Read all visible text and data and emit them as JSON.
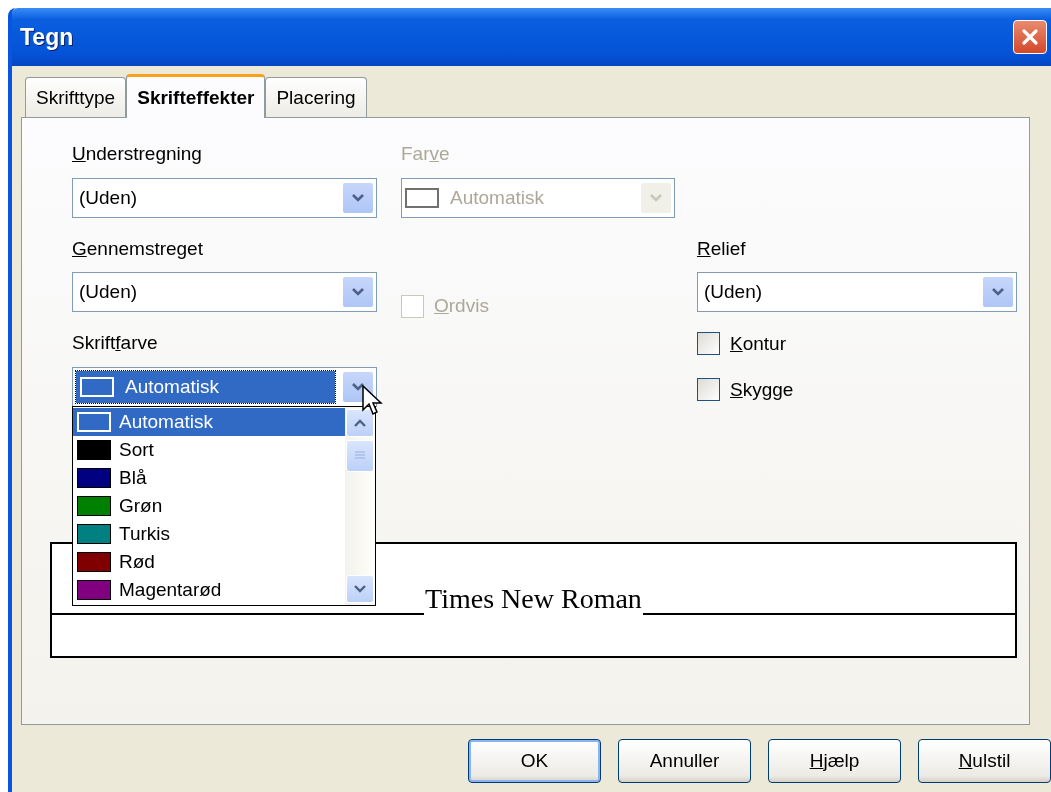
{
  "window": {
    "title": "Tegn"
  },
  "tabs": [
    {
      "label": "Skrifttype",
      "selected": false
    },
    {
      "label": "Skrifteffekter",
      "selected": true
    },
    {
      "label": "Placering",
      "selected": false
    }
  ],
  "understregning": {
    "label_parts": [
      {
        "text": "U",
        "underline": true
      },
      {
        "text": "nderstregning",
        "underline": false
      }
    ],
    "value": "(Uden)",
    "disabled": false
  },
  "farve": {
    "label_parts": [
      {
        "text": "Far",
        "underline": false
      },
      {
        "text": "v",
        "underline": true
      },
      {
        "text": "e",
        "underline": false
      }
    ],
    "value": "Automatisk",
    "disabled": true
  },
  "gennemstreget": {
    "label_parts": [
      {
        "text": "G",
        "underline": true
      },
      {
        "text": "ennemstreget",
        "underline": false
      }
    ],
    "value": "(Uden)",
    "disabled": false
  },
  "ordvis": {
    "label_parts": [
      {
        "text": "O",
        "underline": true
      },
      {
        "text": "rdvis",
        "underline": false
      }
    ],
    "checked": false,
    "disabled": true
  },
  "relief": {
    "label_parts": [
      {
        "text": "R",
        "underline": true
      },
      {
        "text": "elief",
        "underline": false
      }
    ],
    "value": "(Uden)",
    "disabled": false
  },
  "kontur": {
    "label_parts": [
      {
        "text": "K",
        "underline": true
      },
      {
        "text": "ontur",
        "underline": false
      }
    ],
    "checked": false,
    "disabled": false
  },
  "skygge": {
    "label_parts": [
      {
        "text": "S",
        "underline": true
      },
      {
        "text": "kygge",
        "underline": false
      }
    ],
    "checked": false,
    "disabled": false
  },
  "skriftfarve": {
    "label_parts": [
      {
        "text": "Skrift",
        "underline": false
      },
      {
        "text": "f",
        "underline": true
      },
      {
        "text": "arve",
        "underline": false
      }
    ],
    "value": "Automatisk",
    "expanded": true,
    "options": [
      {
        "label": "Automatisk",
        "selected": true
      },
      {
        "label": "Sort",
        "selected": false,
        "color": "#000000"
      },
      {
        "label": "Blå",
        "selected": false,
        "color": "#000080"
      },
      {
        "label": "Grøn",
        "selected": false,
        "color": "#008000"
      },
      {
        "label": "Turkis",
        "selected": false,
        "color": "#008080"
      },
      {
        "label": "Rød",
        "selected": false,
        "color": "#800000"
      },
      {
        "label": "Magentarød",
        "selected": false,
        "color": "#800080"
      }
    ]
  },
  "preview": {
    "text": "Times New Roman"
  },
  "buttons": [
    {
      "label_parts": [
        {
          "text": "OK",
          "underline": false
        }
      ],
      "default": true
    },
    {
      "label_parts": [
        {
          "text": "Annuller",
          "underline": false
        }
      ],
      "default": false
    },
    {
      "label_parts": [
        {
          "text": "H",
          "underline": true
        },
        {
          "text": "jælp",
          "underline": false
        }
      ],
      "default": false
    },
    {
      "label_parts": [
        {
          "text": "N",
          "underline": true
        },
        {
          "text": "ulstil",
          "underline": false
        }
      ],
      "default": false
    }
  ]
}
